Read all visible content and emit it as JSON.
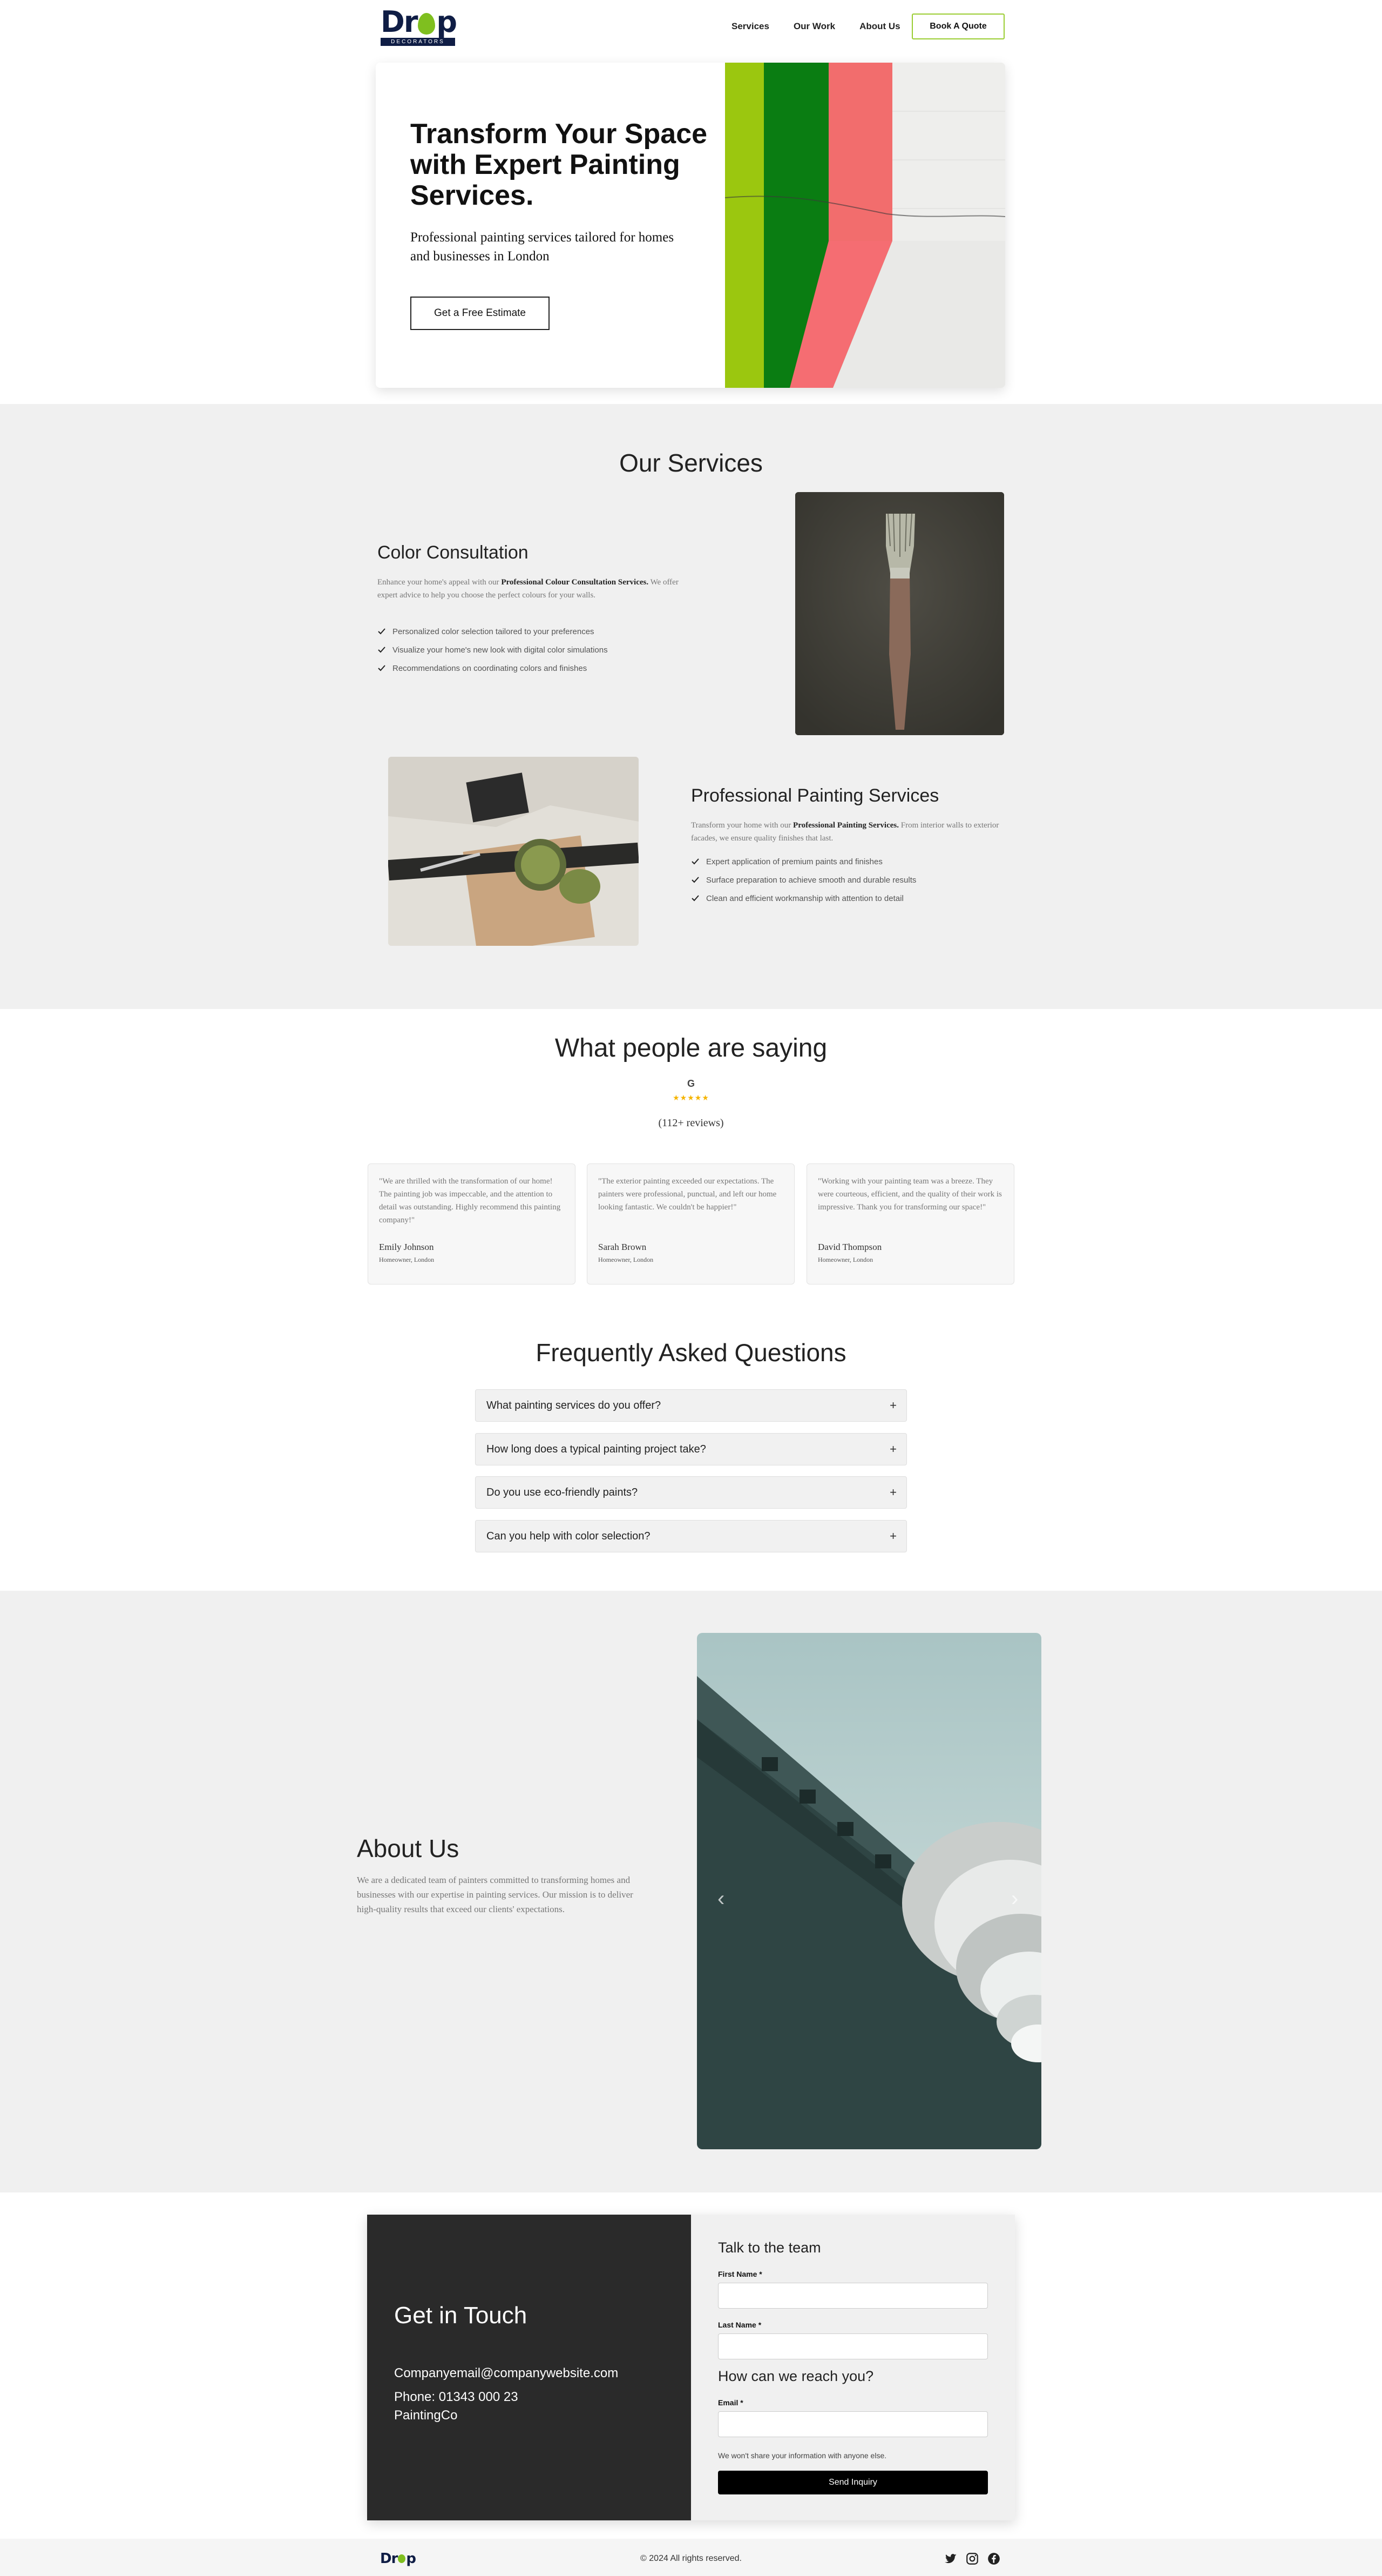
{
  "nav": {
    "logo_text": "Drop",
    "logo_tag": "DECORATORS",
    "links": [
      "Services",
      "Our Work",
      "About Us"
    ],
    "cta": "Book A Quote"
  },
  "hero": {
    "title": "Transform Your Space with Expert Painting Services.",
    "subtitle": "Professional painting services tailored for homes and businesses in London",
    "button": "Get a Free Estimate"
  },
  "services": {
    "title": "Our Services",
    "items": [
      {
        "title": "Color Consultation",
        "desc_pre": "Enhance your home's appeal with our ",
        "desc_bold": "Professional Colour Consultation Services.",
        "desc_post": " We offer expert advice to help you choose the perfect colours for your walls.",
        "bullets": [
          "Personalized color selection tailored to your preferences",
          "Visualize your home's new look with digital color simulations",
          "Recommendations on coordinating colors and finishes"
        ]
      },
      {
        "title": "Professional Painting Services",
        "desc_pre": "Transform your home with our ",
        "desc_bold": "Professional Painting Services.",
        "desc_post": " From interior walls to exterior facades, we ensure quality finishes that last.",
        "bullets": [
          "Expert application of premium paints and finishes",
          "Surface preparation to achieve smooth and durable results",
          "Clean and efficient workmanship with attention to detail"
        ]
      }
    ]
  },
  "reviews": {
    "title": "What people are saying",
    "google": "G",
    "stars": "★★★★★",
    "rating": 5,
    "count": "(112+ reviews)",
    "items": [
      {
        "text": "\"We are thrilled with the transformation of our home! The painting job was impeccable, and the attention to detail was outstanding. Highly recommend this painting company!\"",
        "name": "Emily Johnson",
        "role": "Homeowner, London"
      },
      {
        "text": "\"The exterior painting exceeded our expectations. The painters were professional, punctual, and left our home looking fantastic. We couldn't be happier!\"",
        "name": "Sarah Brown",
        "role": "Homeowner, London"
      },
      {
        "text": "\"Working with your painting team was a breeze. They were courteous, efficient, and the quality of their work is impressive. Thank you for transforming our space!\"",
        "name": "David Thompson",
        "role": "Homeowner, London"
      }
    ]
  },
  "faq": {
    "title": "Frequently Asked Questions",
    "items": [
      "What painting services do you offer?",
      "How long does a typical painting project take?",
      "Do you use eco-friendly paints?",
      "Can you help with color selection?"
    ],
    "toggle": "+"
  },
  "about": {
    "title": "About Us",
    "text": "We are a dedicated team of painters committed to transforming homes and businesses with our expertise in painting services. Our mission is to deliver high-quality results that exceed our clients' expectations.",
    "prev": "‹",
    "next": "›"
  },
  "contact": {
    "title": "Get in Touch",
    "email": "Companyemail@companywebsite.com",
    "phone": "Phone: 01343 000 23",
    "company": "PaintingCo",
    "form_title": "Talk to the team",
    "first_name": "First Name *",
    "last_name": "Last Name *",
    "reach_title": "How can we reach you?",
    "email_label": "Email *",
    "note": "We won't share your information with anyone else.",
    "submit": "Send Inquiry"
  },
  "footer": {
    "logo": "Drop",
    "copyright": "© 2024 All rights reserved."
  },
  "colors": {
    "accent": "#9acd32",
    "brand_navy": "#0f1d45",
    "section_bg": "#f0f0f0",
    "dark_panel": "#2a2a2a"
  }
}
